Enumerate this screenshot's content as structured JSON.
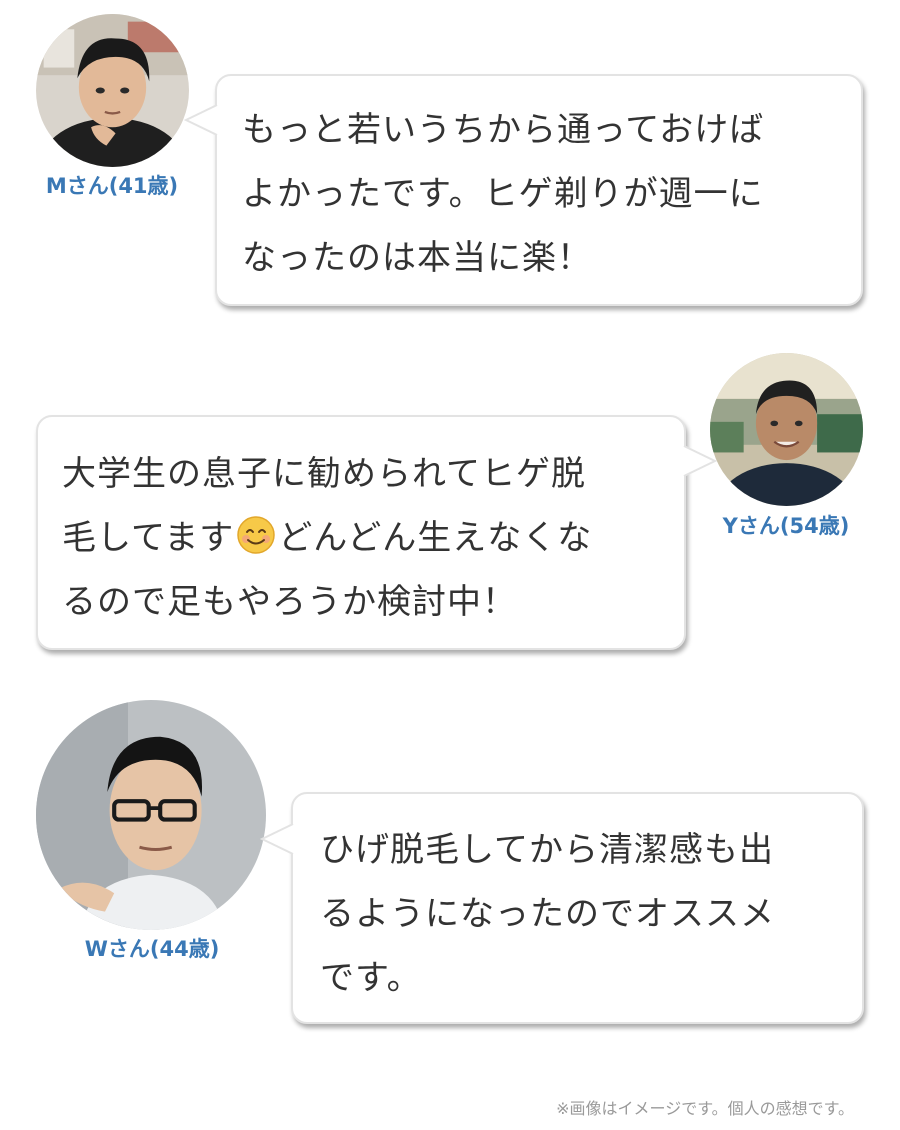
{
  "testimonials": [
    {
      "name": "Mさん(41歳)",
      "lines": [
        "もっと若いうちから通っておけば",
        "よかったです。ヒゲ剃りが週一に",
        "なったのは本当に楽！"
      ]
    },
    {
      "name": "Yさん(54歳)",
      "lines": [
        "大学生の息子に勧められてヒゲ脱",
        "毛してます",
        "どんどん生えなくな",
        "るので足もやろうか検討中！"
      ],
      "emoji": "smiling-face-emoji"
    },
    {
      "name": "Wさん(44歳)",
      "lines": [
        "ひげ脱毛してから清潔感も出",
        "るようになったのでオススメ",
        "です。"
      ]
    }
  ],
  "disclaimer": "※画像はイメージです。個人の感想です。",
  "colors": {
    "name_text": "#3a78b5",
    "bubble_border": "#e3e3e3",
    "body_text": "#333333"
  }
}
